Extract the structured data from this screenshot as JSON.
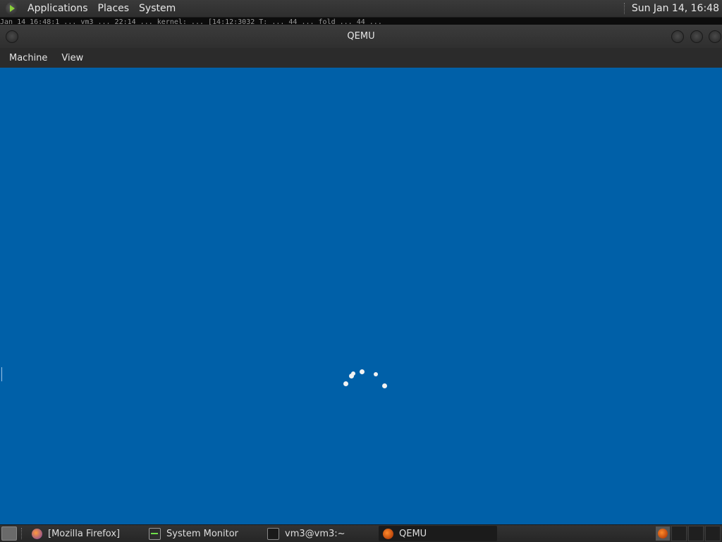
{
  "top_panel": {
    "menus": [
      "Applications",
      "Places",
      "System"
    ],
    "clock": "Sun Jan 14, 16:48",
    "icons": {
      "menu_logo": "linux-mint-logo-icon"
    }
  },
  "background_terminal": {
    "text": "Jan 14 16:48:1 ... vm3 ... 22:14 ... kernel: ... [14:12:3032 T: ... 44 ... fold ... 44 ..."
  },
  "window": {
    "title": "QEMU",
    "menus": [
      "Machine",
      "View"
    ]
  },
  "vm_screen": {
    "background_color": "#0060a8",
    "state": "loading",
    "spinner_icon": "loading-spinner-icon"
  },
  "taskbar": {
    "items": [
      {
        "label": "[Mozilla Firefox]",
        "icon": "firefox-icon",
        "active": false
      },
      {
        "label": "System Monitor",
        "icon": "system-monitor-icon",
        "active": false
      },
      {
        "label": "vm3@vm3:~",
        "icon": "terminal-icon",
        "active": false
      },
      {
        "label": "QEMU",
        "icon": "qemu-icon",
        "active": true
      }
    ]
  }
}
